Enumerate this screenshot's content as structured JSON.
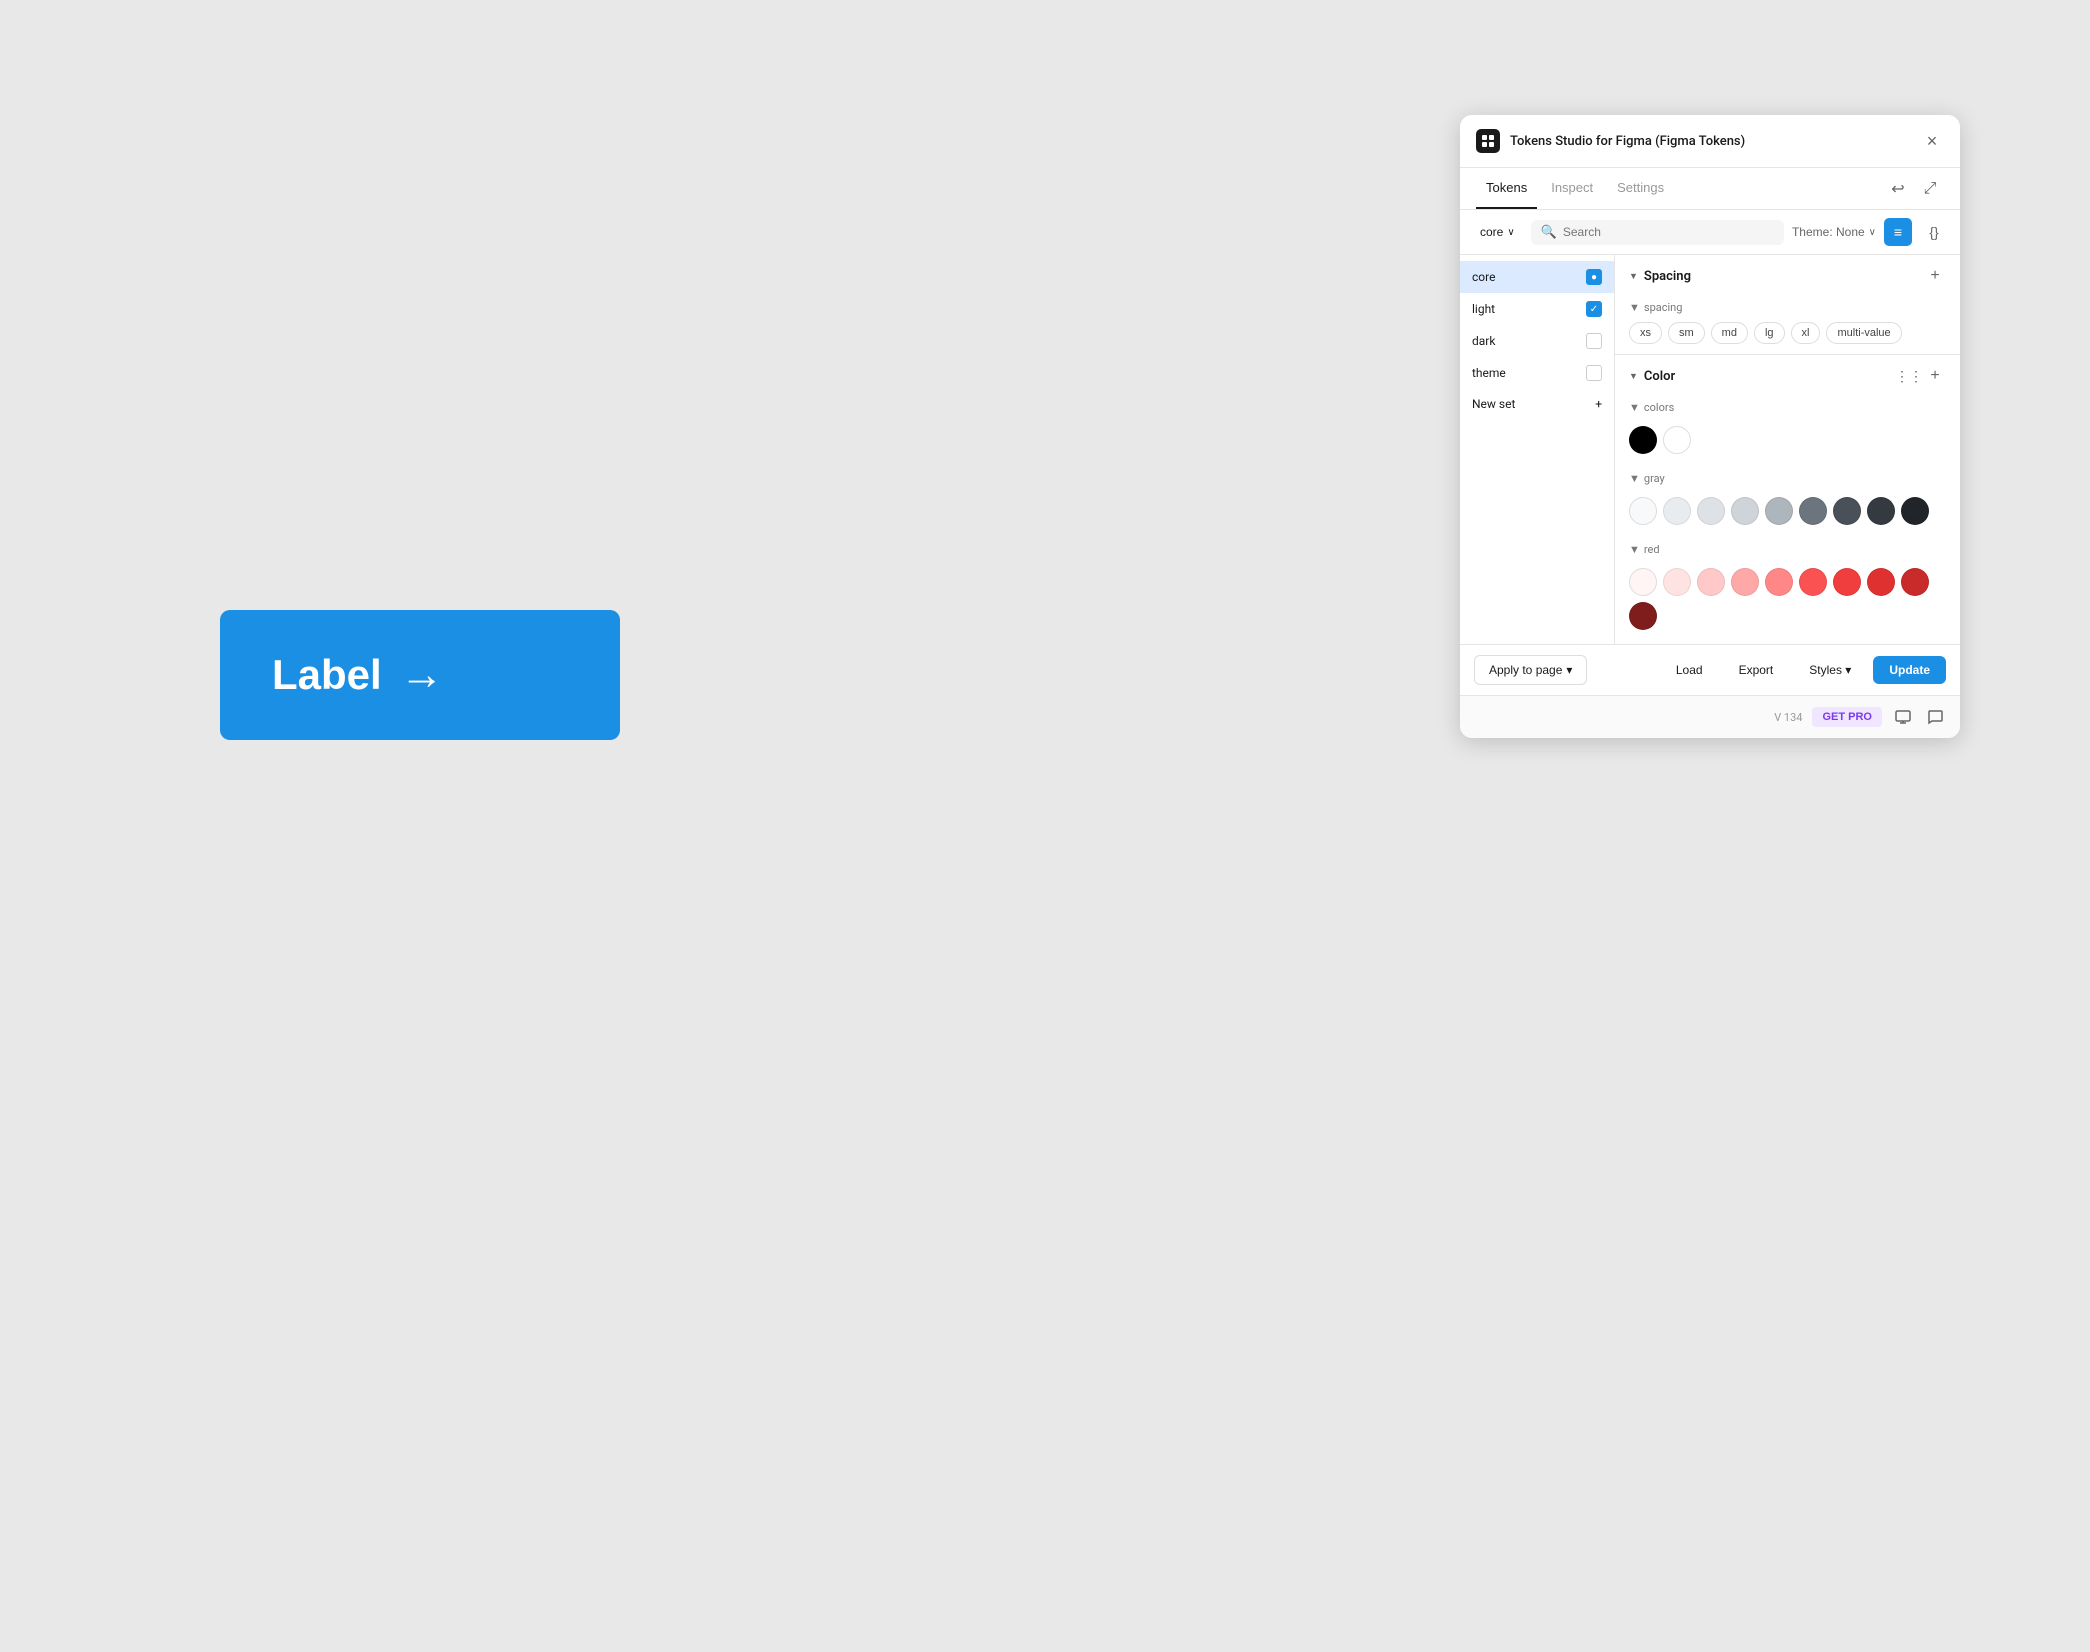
{
  "canvas": {
    "button_label": "Label",
    "button_arrow": "→"
  },
  "panel": {
    "title": "Tokens Studio for Figma (Figma Tokens)",
    "close_label": "×",
    "tabs": [
      {
        "id": "tokens",
        "label": "Tokens",
        "active": true
      },
      {
        "id": "inspect",
        "label": "Inspect",
        "active": false
      },
      {
        "id": "settings",
        "label": "Settings",
        "active": false
      }
    ],
    "toolbar": {
      "set_name": "core",
      "set_chevron": "∨",
      "search_placeholder": "Search",
      "theme_label": "Theme: None",
      "theme_chevron": "∨"
    },
    "sidebar": {
      "items": [
        {
          "id": "core",
          "label": "core",
          "checked": "blue"
        },
        {
          "id": "light",
          "label": "light",
          "checked": "check"
        },
        {
          "id": "dark",
          "label": "dark",
          "checked": "none"
        },
        {
          "id": "theme",
          "label": "theme",
          "checked": "none"
        }
      ],
      "new_set_label": "New set",
      "new_set_icon": "+"
    },
    "spacing_section": {
      "title": "Spacing",
      "add_icon": "+",
      "subsection_label": "spacing",
      "tokens": [
        "xs",
        "sm",
        "md",
        "lg",
        "xl",
        "multi-value"
      ]
    },
    "color_section": {
      "title": "Color",
      "add_icon": "+",
      "subsections": [
        {
          "label": "colors",
          "dots": [
            {
              "color": "#000000"
            },
            {
              "color": "#ffffff"
            }
          ]
        },
        {
          "label": "gray",
          "dots": [
            {
              "color": "#f8f9fa"
            },
            {
              "color": "#e9ecef"
            },
            {
              "color": "#dee2e6"
            },
            {
              "color": "#ced4da"
            },
            {
              "color": "#adb5bd"
            },
            {
              "color": "#6c757d"
            },
            {
              "color": "#495057"
            },
            {
              "color": "#343a40"
            },
            {
              "color": "#212529"
            }
          ]
        },
        {
          "label": "red",
          "dots": [
            {
              "color": "#fff5f5"
            },
            {
              "color": "#ffe3e3"
            },
            {
              "color": "#ffc9c9"
            },
            {
              "color": "#ffa8a8"
            },
            {
              "color": "#ff8787"
            },
            {
              "color": "#fa5252"
            },
            {
              "color": "#f03e3e"
            },
            {
              "color": "#e03131"
            },
            {
              "color": "#c92a2a"
            },
            {
              "color": "#a61e4d"
            }
          ]
        }
      ]
    },
    "footer": {
      "apply_label": "Apply to page",
      "apply_chevron": "▾",
      "load_label": "Load",
      "export_label": "Export",
      "styles_label": "Styles",
      "styles_chevron": "▾",
      "update_label": "Update"
    },
    "bottom_bar": {
      "version": "V 134",
      "get_pro": "GET PRO",
      "monitor_icon": "□",
      "chat_icon": "◻"
    }
  }
}
